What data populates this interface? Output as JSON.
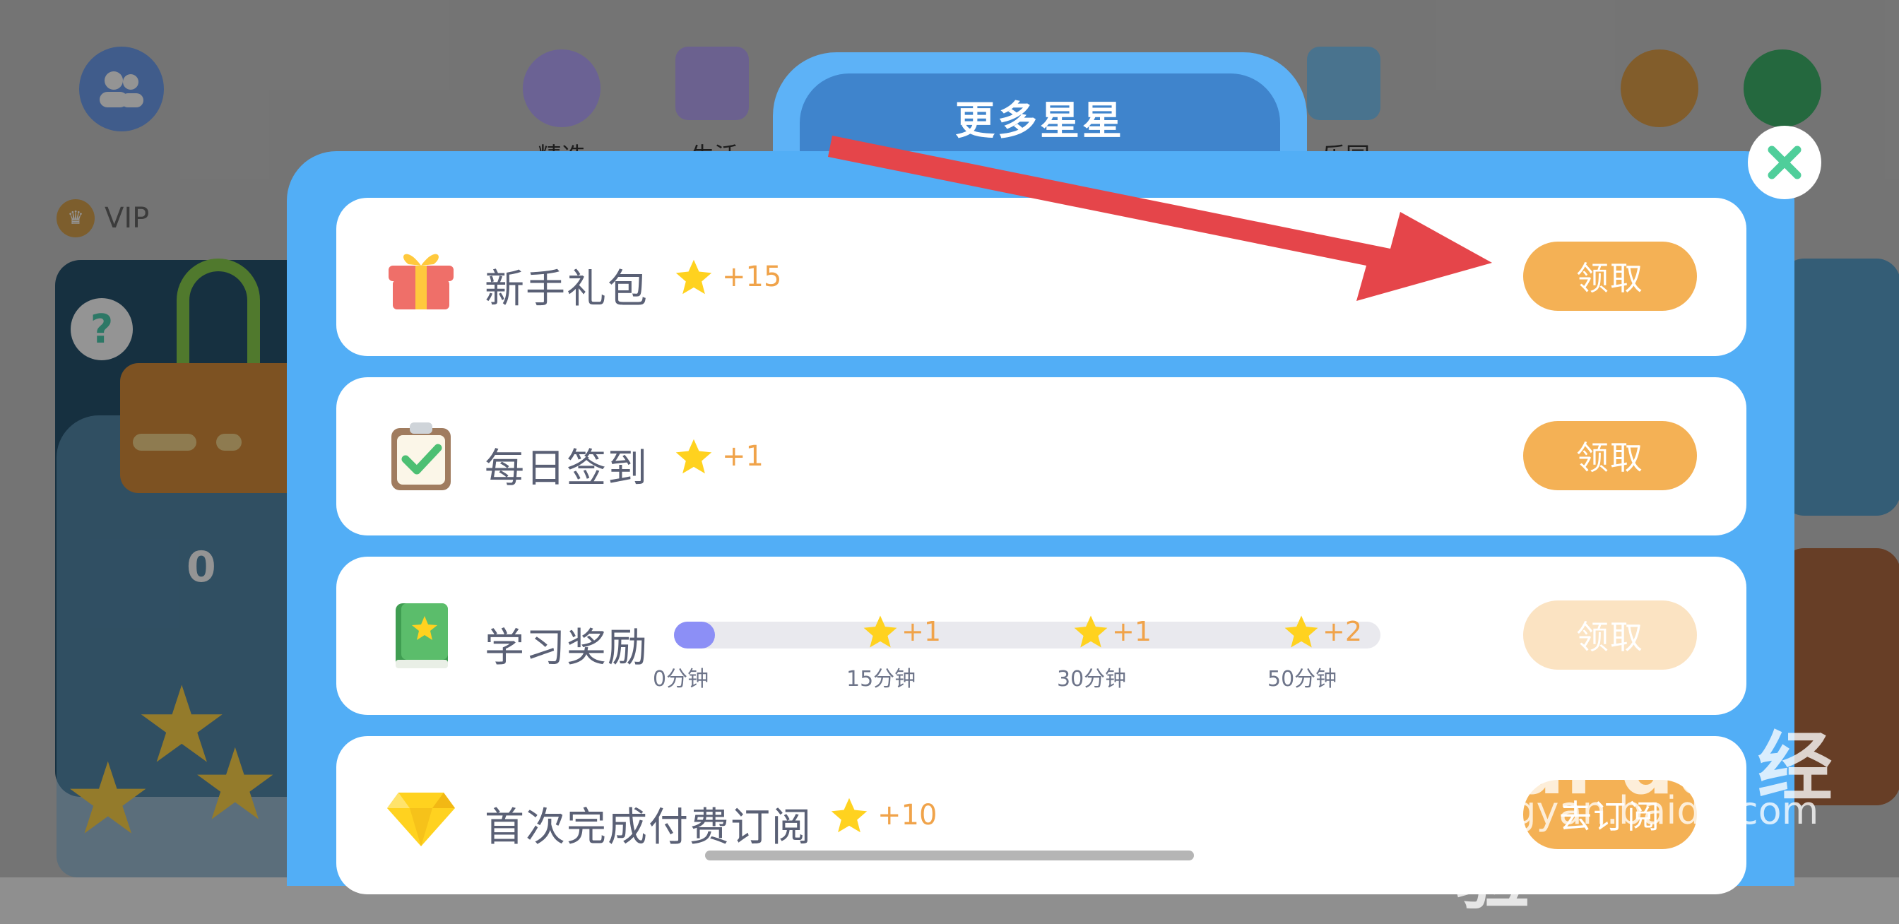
{
  "background_app": {
    "nav": [
      {
        "label": "精选"
      },
      {
        "label": "生活"
      },
      {
        "label": "乐园"
      }
    ],
    "vip_label": "VIP",
    "jar_count": "0"
  },
  "modal": {
    "title": "更多星星",
    "tasks": [
      {
        "title": "新手礼包",
        "reward": "+15",
        "button": "领取",
        "button_state": "enabled",
        "icon": "gift-icon"
      },
      {
        "title": "每日签到",
        "reward": "+1",
        "button": "领取",
        "button_state": "enabled",
        "icon": "clipboard-check-icon"
      },
      {
        "title": "学习奖励",
        "button": "领取",
        "button_state": "disabled",
        "icon": "book-star-icon",
        "progress": {
          "fraction": 0.02,
          "milestones": [
            {
              "reward": "+1",
              "label": "15分钟"
            },
            {
              "reward": "+1",
              "label": "30分钟"
            },
            {
              "reward": "+2",
              "label": "50分钟"
            }
          ],
          "start_label": "0分钟"
        }
      },
      {
        "title": "首次完成付费订阅",
        "reward": "+10",
        "button": "去订阅",
        "button_state": "enabled",
        "icon": "diamond-icon"
      }
    ]
  },
  "watermark": {
    "main": "Bai du 经验",
    "sub": "jingyan.baidu.com"
  },
  "colors": {
    "modal_blue": "#52aef6",
    "tab_blue": "#3f84cc",
    "button_orange": "#f4b155",
    "reward_orange": "#f0a34a",
    "arrow_red": "#e5454a"
  }
}
